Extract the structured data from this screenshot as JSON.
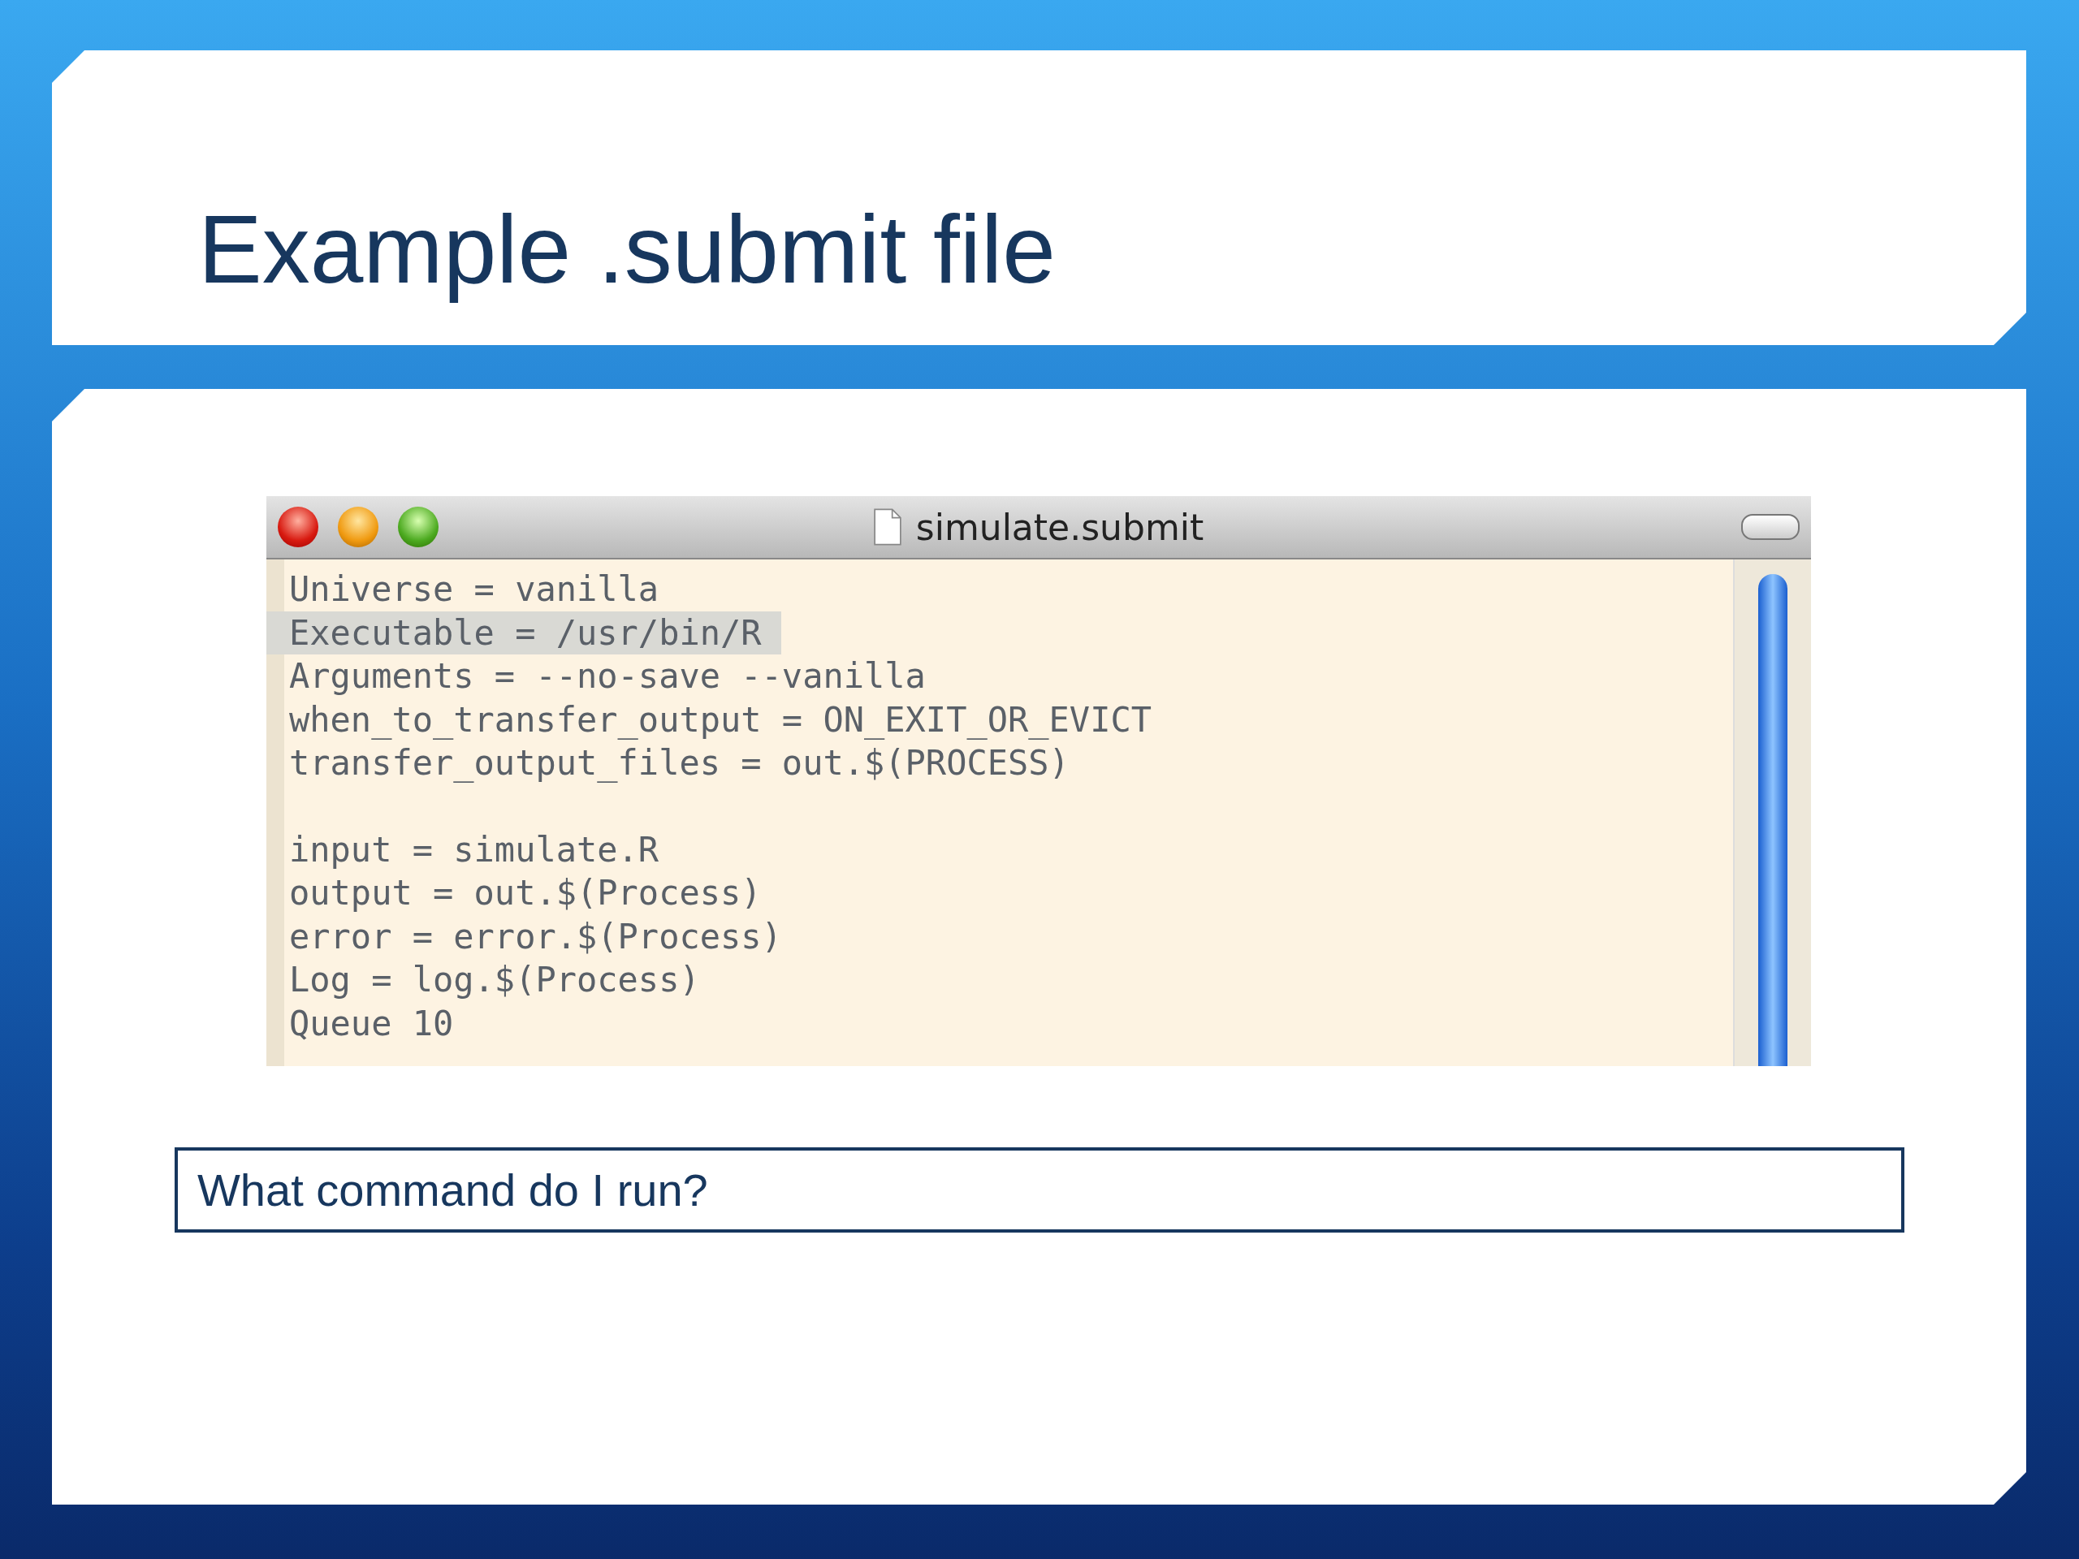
{
  "slide": {
    "title": "Example .submit file"
  },
  "editor_window": {
    "title": "simulate.submit",
    "blocks": [
      {
        "lines": [
          {
            "text": "Universe = vanilla",
            "selected": false
          },
          {
            "text": "Executable = /usr/bin/R",
            "selected": true
          },
          {
            "text": "Arguments = --no-save --vanilla",
            "selected": false
          },
          {
            "text": "when_to_transfer_output = ON_EXIT_OR_EVICT",
            "selected": false
          },
          {
            "text": "transfer_output_files = out.$(PROCESS)",
            "selected": false
          }
        ]
      },
      {
        "lines": [
          {
            "text": "input = simulate.R",
            "selected": false
          },
          {
            "text": "output = out.$(Process)",
            "selected": false
          },
          {
            "text": "error = error.$(Process)",
            "selected": false
          },
          {
            "text": "Log = log.$(Process)",
            "selected": false
          },
          {
            "text": "Queue 10",
            "selected": false
          }
        ]
      }
    ]
  },
  "question": "What command do I run?"
}
